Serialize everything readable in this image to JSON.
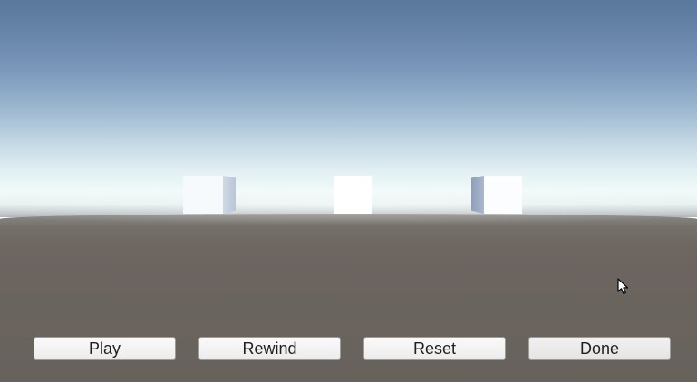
{
  "scene": {
    "sky_top_color": "#5a779c",
    "horizon_color": "#f1faf9",
    "ground_color": "#68625d",
    "cube_color": "#ffffff",
    "cubes": [
      "cube-left",
      "cube-center",
      "cube-right"
    ]
  },
  "controls": {
    "play_label": "Play",
    "rewind_label": "Rewind",
    "reset_label": "Reset",
    "done_label": "Done"
  },
  "cursor": {
    "icon": "mouse-pointer-icon"
  }
}
